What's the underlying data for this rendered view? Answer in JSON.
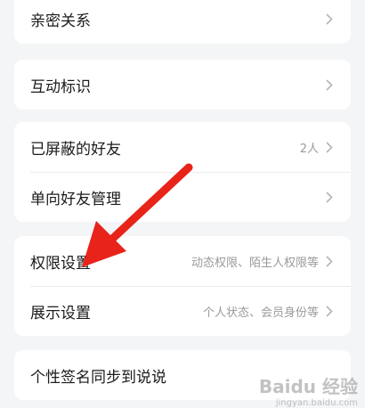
{
  "groups": [
    {
      "items": [
        {
          "label": "亲密关系",
          "value": ""
        }
      ]
    },
    {
      "items": [
        {
          "label": "互动标识",
          "value": ""
        }
      ]
    },
    {
      "items": [
        {
          "label": "已屏蔽的好友",
          "value": "2人"
        },
        {
          "label": "单向好友管理",
          "value": ""
        }
      ]
    },
    {
      "items": [
        {
          "label": "权限设置",
          "value": "动态权限、陌生人权限等"
        },
        {
          "label": "展示设置",
          "value": "个人状态、会员身份等"
        }
      ]
    },
    {
      "items": [
        {
          "label": "个性签名同步到说说",
          "value": ""
        }
      ]
    }
  ],
  "annotation": {
    "arrow_color": "#e8231a"
  },
  "watermark": {
    "text": "Baidu 经验",
    "sub": "jingyan.baidu.com"
  }
}
